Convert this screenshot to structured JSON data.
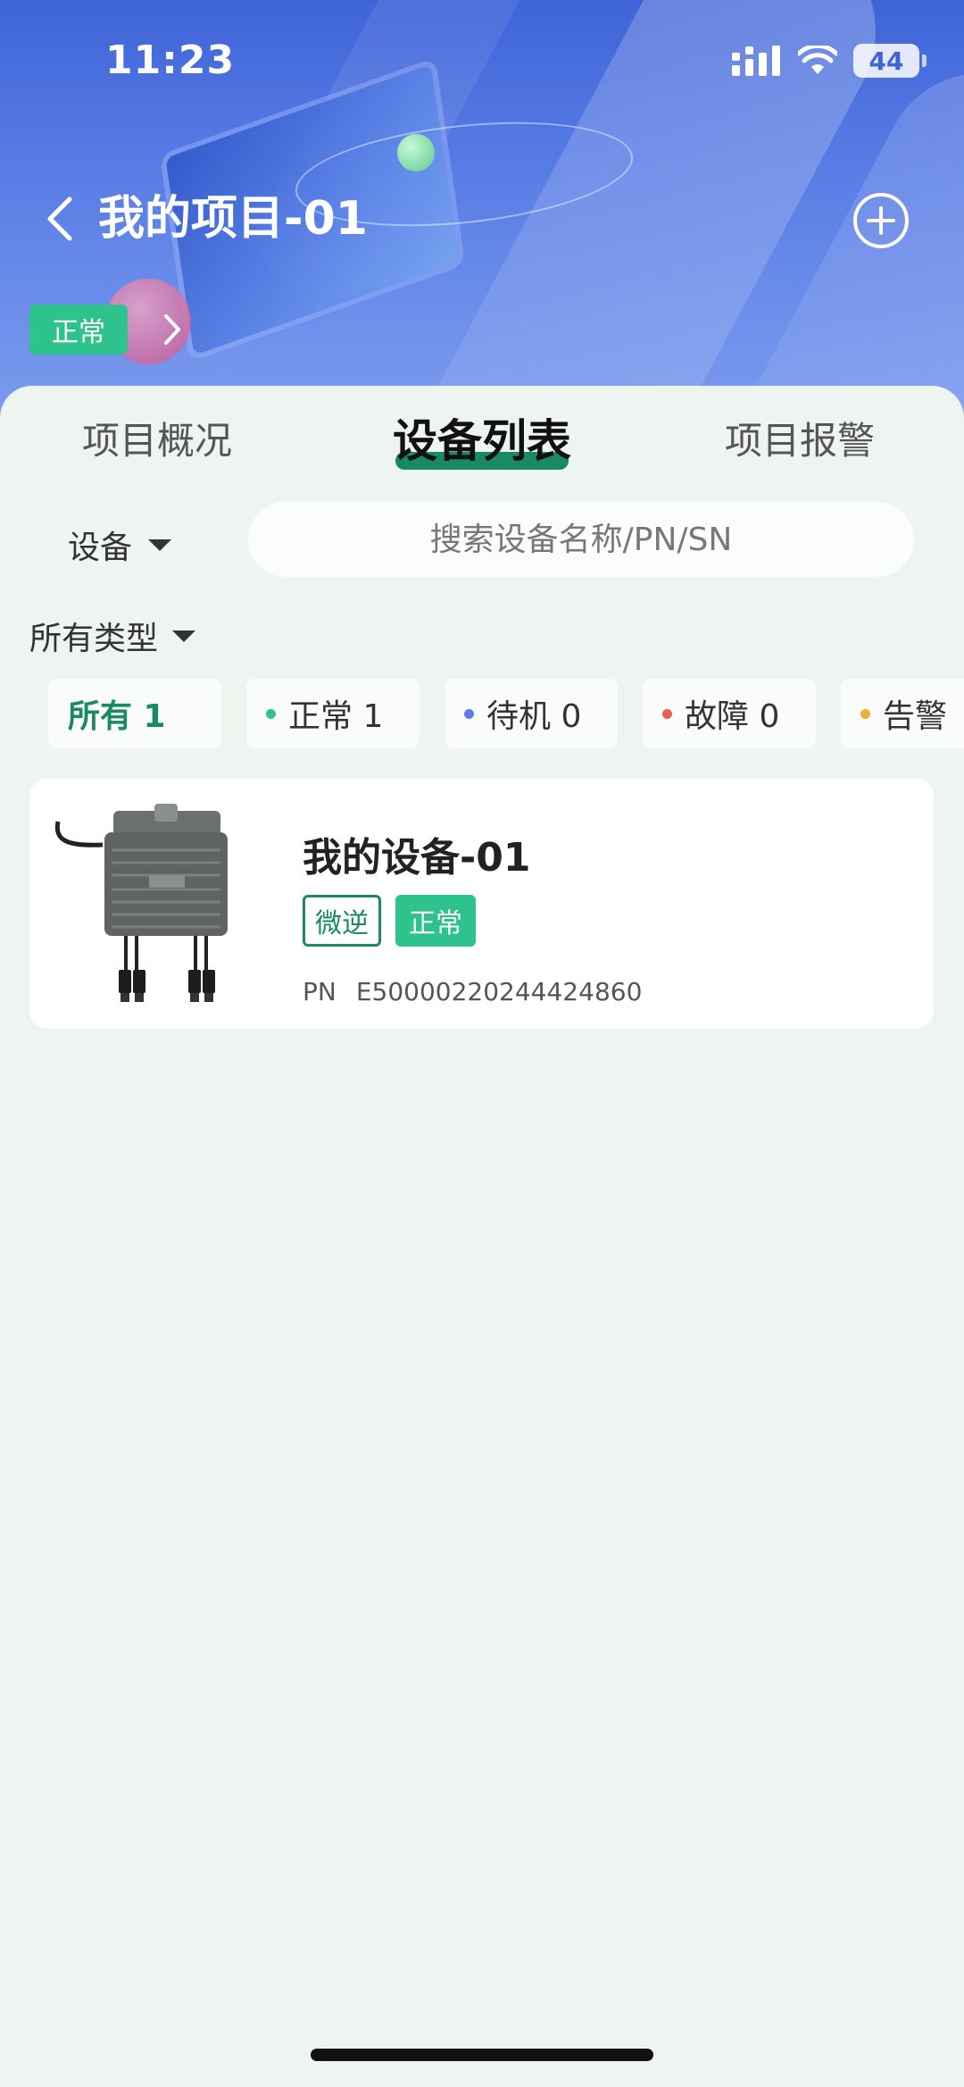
{
  "status_bar": {
    "time": "11:23",
    "battery": "44"
  },
  "header": {
    "title": "我的项目-01",
    "project_status": "正常"
  },
  "tabs": [
    {
      "label": "项目概况",
      "active": false
    },
    {
      "label": "设备列表",
      "active": true
    },
    {
      "label": "项目报警",
      "active": false
    }
  ],
  "filters": {
    "device_selector": "设备",
    "search_placeholder": "搜索设备名称/PN/SN",
    "type_selector": "所有类型"
  },
  "status_chips": [
    {
      "label": "所有 1",
      "dot_color": "",
      "active": true
    },
    {
      "label": "正常 1",
      "dot_color": "#2ec38d",
      "active": false
    },
    {
      "label": "待机 0",
      "dot_color": "#5b7fe6",
      "active": false
    },
    {
      "label": "故障 0",
      "dot_color": "#ef5a5a",
      "active": false
    },
    {
      "label": "告警",
      "dot_color": "#f0b030",
      "active": false
    }
  ],
  "devices": [
    {
      "name": "我的设备-01",
      "type_tag": "微逆",
      "status_tag": "正常",
      "pn_label": "PN",
      "pn_value": "E50000220244424860",
      "icon": "microinverter-image"
    }
  ],
  "colors": {
    "accent_green": "#1a8a63",
    "status_green": "#2ec38d",
    "header_blue": "#3f64d8",
    "background": "#eef5f1"
  }
}
